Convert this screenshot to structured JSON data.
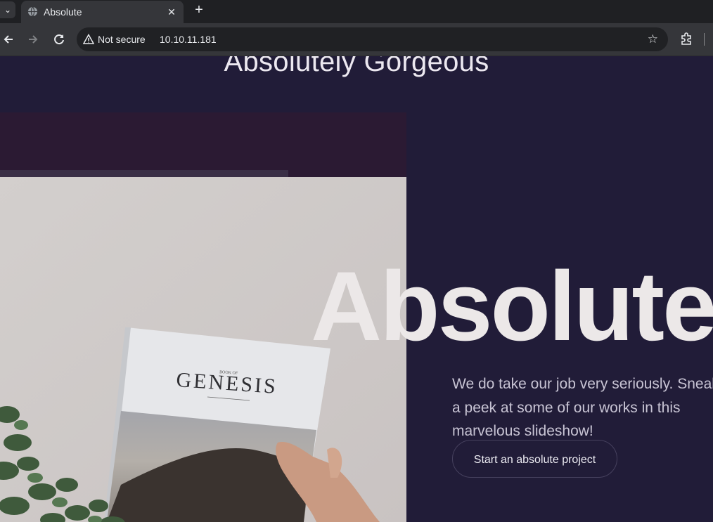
{
  "browser": {
    "tab_title": "Absolute",
    "security_label": "Not secure",
    "url": "10.10.11.181",
    "icons": [
      "tab-search-icon",
      "globe-icon",
      "close-icon",
      "plus-icon",
      "back-icon",
      "forward-icon",
      "reload-icon",
      "warning-icon",
      "star-icon",
      "extensions-icon"
    ]
  },
  "page": {
    "heading": "Absolutely Gorgeous",
    "hero_title": "Absolute",
    "hero_text": "We do take our job very seriously. Sneak a peek at some of our works in this marvelous slideshow!",
    "cta_label": "Start an absolute project",
    "image_text": {
      "small": "BOOK OF",
      "large": "GENESIS"
    }
  },
  "colors": {
    "page_bg": "#211c38",
    "hero_title": "#ece8e8",
    "chrome_dark": "#1f2023",
    "chrome_toolbar": "#35363a"
  }
}
